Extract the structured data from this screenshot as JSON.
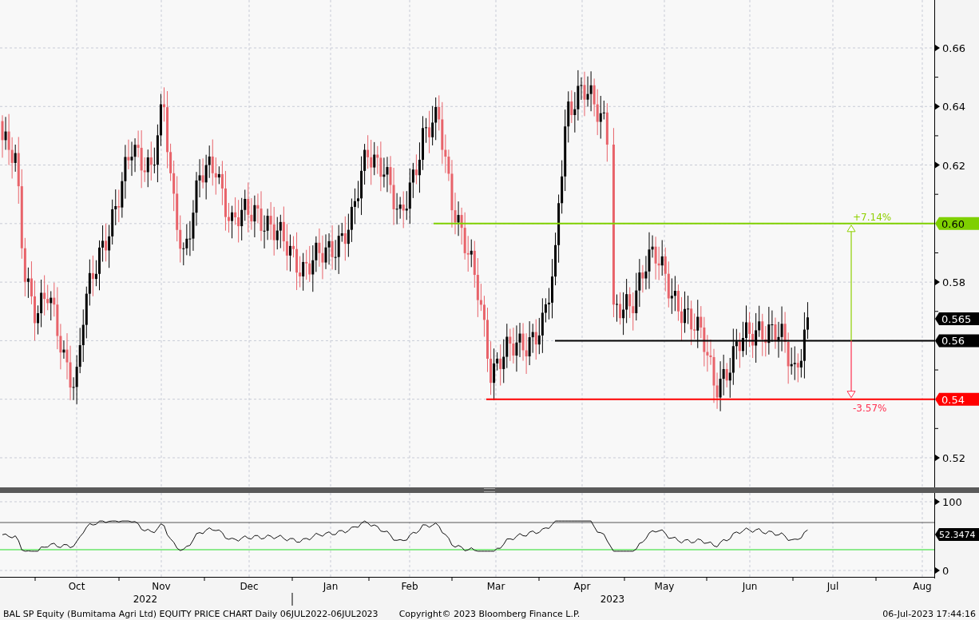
{
  "price_axis": {
    "ticks": [
      "0.66",
      "0.64",
      "0.62",
      "0.58",
      "0.52"
    ]
  },
  "levels": [
    {
      "label": "0.60",
      "color": "#7fd000"
    },
    {
      "label": "0.565",
      "color": "#000000"
    },
    {
      "label": "0.56",
      "color": "#000000"
    },
    {
      "label": "0.54",
      "color": "#ff0000"
    }
  ],
  "targets": [
    {
      "text": "+7.14%",
      "color": "#8fd000"
    },
    {
      "text": "-3.57%",
      "color": "#ff3050"
    }
  ],
  "rsi": {
    "ticks": [
      "100",
      "0"
    ],
    "value": "52.3474"
  },
  "x_axis": {
    "months": [
      "Oct",
      "Nov",
      "Dec",
      "Jan",
      "Feb",
      "Mar",
      "Apr",
      "May",
      "Jun",
      "Jul",
      "Aug"
    ],
    "years": [
      "2022",
      "2023"
    ]
  },
  "footer": {
    "title": "BAL SP Equity (Bumitama Agri Ltd) EQUITY PRICE CHART  Daily 06JUL2022-06JUL2023",
    "copyright": "Copyright© 2023 Bloomberg Finance L.P.",
    "timestamp": "06-Jul-2023 17:44:16"
  }
}
